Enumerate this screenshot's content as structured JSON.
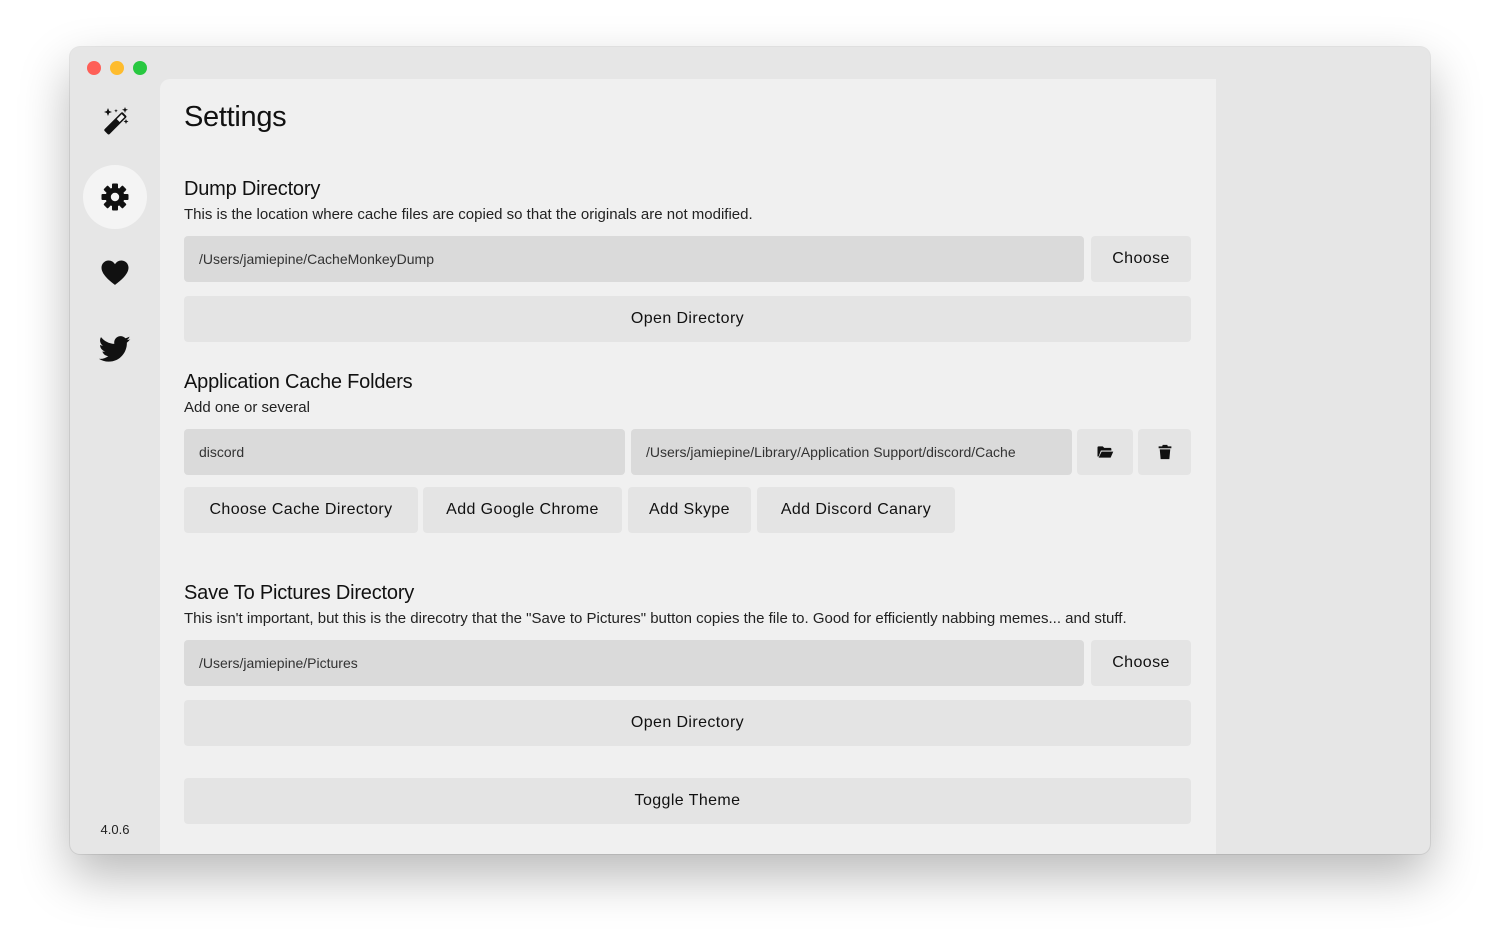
{
  "window": {
    "traffic_lights": [
      "close",
      "minimize",
      "maximize"
    ]
  },
  "sidebar": {
    "items": [
      {
        "icon": "magic-wand-icon",
        "active": false
      },
      {
        "icon": "gear-icon",
        "active": true
      },
      {
        "icon": "heart-icon",
        "active": false
      },
      {
        "icon": "twitter-bird-icon",
        "active": false
      }
    ],
    "version": "4.0.6"
  },
  "main": {
    "title": "Settings",
    "dump_directory": {
      "title": "Dump Directory",
      "description": "This is the location where cache files are copied so that the originals are not modified.",
      "path": "/Users/jamiepine/CacheMonkeyDump",
      "choose_label": "Choose",
      "open_label": "Open Directory"
    },
    "cache_folders": {
      "title": "Application Cache Folders",
      "description": "Add one or several",
      "entries": [
        {
          "name": "discord",
          "path": "/Users/jamiepine/Library/Application Support/discord/Cache"
        }
      ],
      "buttons": {
        "choose_cache": "Choose Cache Directory",
        "add_chrome": "Add Google Chrome",
        "add_skype": "Add Skype",
        "add_discord_canary": "Add Discord Canary"
      }
    },
    "pictures_directory": {
      "title": "Save To Pictures Directory",
      "description": "This isn't important, but this is the direcotry that the \"Save to Pictures\" button copies the file to. Good for efficiently nabbing memes... and stuff.",
      "path": "/Users/jamiepine/Pictures",
      "choose_label": "Choose",
      "open_label": "Open Directory"
    },
    "toggle_theme_label": "Toggle Theme"
  },
  "colors": {
    "window_bg": "#e6e6e6",
    "content_bg": "#f0f0f0",
    "field_bg": "#dadada",
    "button_bg": "#e4e4e4",
    "traffic_close": "#fe5f57",
    "traffic_minimize": "#febc2e",
    "traffic_maximize": "#28c840"
  }
}
